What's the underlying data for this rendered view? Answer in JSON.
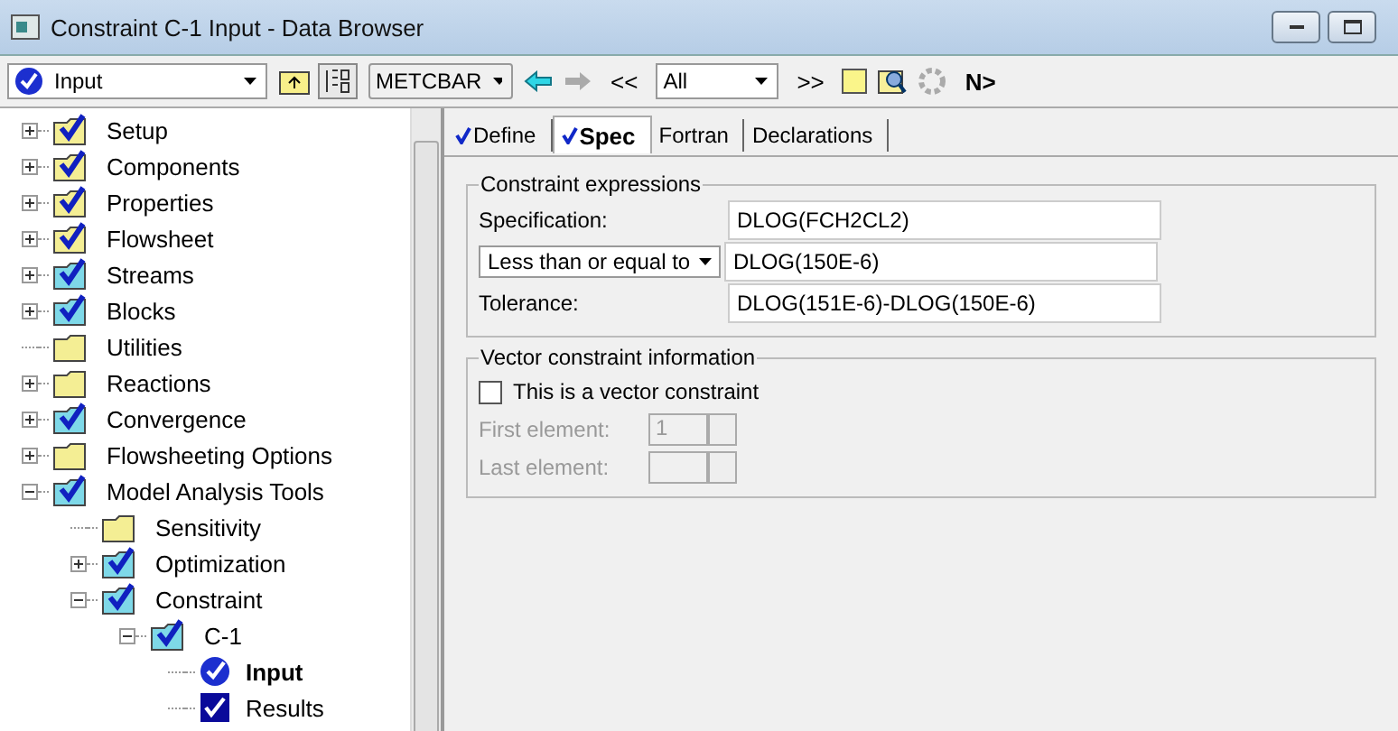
{
  "window": {
    "title": "Constraint C-1 Input - Data Browser"
  },
  "toolbar": {
    "form_select": "Input",
    "units_select": "METCBAR",
    "filter_select": "All",
    "prev_label": "<<",
    "next_label": ">>",
    "next_button": "N>"
  },
  "tree": [
    {
      "label": "Setup",
      "expanded": false,
      "checked": true,
      "color": "#f4ee94",
      "kind": "folder"
    },
    {
      "label": "Components",
      "expanded": false,
      "checked": true,
      "color": "#f4ee94",
      "kind": "folder"
    },
    {
      "label": "Properties",
      "expanded": false,
      "checked": true,
      "color": "#f4ee94",
      "kind": "folder"
    },
    {
      "label": "Flowsheet",
      "expanded": false,
      "checked": true,
      "color": "#f4ee94",
      "kind": "folder"
    },
    {
      "label": "Streams",
      "expanded": false,
      "checked": true,
      "color": "#7ed8e8",
      "kind": "folder"
    },
    {
      "label": "Blocks",
      "expanded": false,
      "checked": true,
      "color": "#7ed8e8",
      "kind": "folder"
    },
    {
      "label": "Utilities",
      "checked": false,
      "color": "#f4ee94",
      "kind": "folder"
    },
    {
      "label": "Reactions",
      "expanded": false,
      "checked": false,
      "color": "#f4ee94",
      "kind": "folder"
    },
    {
      "label": "Convergence",
      "expanded": false,
      "checked": true,
      "color": "#7ed8e8",
      "kind": "folder"
    },
    {
      "label": "Flowsheeting Options",
      "expanded": false,
      "checked": false,
      "color": "#f4ee94",
      "kind": "folder"
    },
    {
      "label": "Model Analysis Tools",
      "expanded": true,
      "checked": true,
      "color": "#7ed8e8",
      "kind": "folder",
      "children": [
        {
          "label": "Sensitivity",
          "checked": false,
          "color": "#f4ee94",
          "kind": "folder"
        },
        {
          "label": "Optimization",
          "expanded": false,
          "checked": true,
          "color": "#7ed8e8",
          "kind": "folder"
        },
        {
          "label": "Constraint",
          "expanded": true,
          "checked": true,
          "color": "#7ed8e8",
          "kind": "folder",
          "children": [
            {
              "label": "C-1",
              "expanded": true,
              "checked": true,
              "color": "#7ed8e8",
              "kind": "folder",
              "children": [
                {
                  "label": "Input",
                  "selected": true,
                  "kind": "input"
                },
                {
                  "label": "Results",
                  "selected": false,
                  "kind": "results"
                }
              ]
            }
          ]
        }
      ]
    }
  ],
  "tabs": [
    {
      "label": "Define",
      "selected": false,
      "checked": true
    },
    {
      "label": "Spec",
      "selected": true,
      "checked": true
    },
    {
      "label": "Fortran",
      "selected": false,
      "checked": false
    },
    {
      "label": "Declarations",
      "selected": false,
      "checked": false
    }
  ],
  "constraint_expressions": {
    "title": "Constraint expressions",
    "specification_label": "Specification:",
    "specification": "DLOG(FCH2CL2)",
    "relation": "Less than or equal to",
    "bound": "DLOG(150E-6)",
    "tolerance_label": "Tolerance:",
    "tolerance": "DLOG(151E-6)-DLOG(150E-6)"
  },
  "vector_constraint": {
    "title": "Vector constraint information",
    "checkbox_label": "This is a vector constraint",
    "checked": false,
    "first_label": "First element:",
    "first_value": "1",
    "last_label": "Last element:"
  }
}
